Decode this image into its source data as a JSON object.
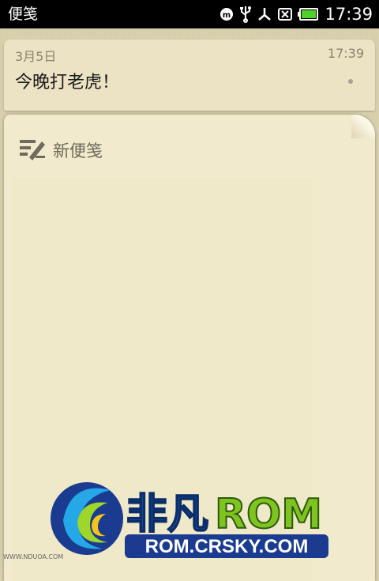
{
  "status_bar": {
    "app_title": "便笺",
    "time": "17:39",
    "icons": [
      "m-notification-icon",
      "usb-icon",
      "usb-debug-icon",
      "no-sim-icon",
      "battery-icon"
    ]
  },
  "note": {
    "date": "3月5日",
    "time": "17:39",
    "text": "今晚打老虎！"
  },
  "new_note": {
    "label": "新便笺",
    "icon": "new-note-icon"
  },
  "watermark": {
    "brand_cn": "非凡",
    "brand_en": "ROM",
    "domain": "ROM.CRSKY.COM",
    "small_text": "WWW.NDUOA.COM",
    "colors": {
      "brand_cn": "#1e7fd8",
      "brand_en": "#7ec31f",
      "domain_bg": "#1a3b8f"
    }
  }
}
